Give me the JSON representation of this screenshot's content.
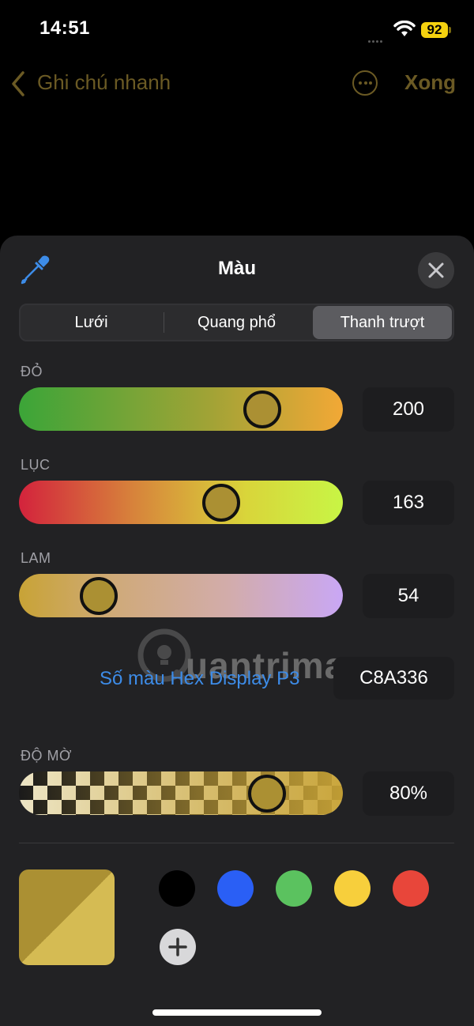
{
  "status_bar": {
    "time": "14:51",
    "battery": "92"
  },
  "nav": {
    "back_label": "Ghi chú nhanh",
    "done_label": "Xong"
  },
  "sheet": {
    "title": "Màu",
    "tabs": [
      {
        "label": "Lưới",
        "selected": false
      },
      {
        "label": "Quang phổ",
        "selected": false
      },
      {
        "label": "Thanh trượt",
        "selected": true
      }
    ]
  },
  "sliders": {
    "red": {
      "label": "ĐỎ",
      "value": "200",
      "fraction": 0.785
    },
    "green": {
      "label": "LỤC",
      "value": "163",
      "fraction": 0.64
    },
    "blue": {
      "label": "LAM",
      "value": "54",
      "fraction": 0.212
    },
    "opacity": {
      "label": "ĐỘ MỜ",
      "value": "80%",
      "fraction": 0.8
    }
  },
  "hex": {
    "label": "Số màu Hex Display P3",
    "value": "C8A336"
  },
  "colors": {
    "accent": "#6b5a24",
    "selected": "#c8a336",
    "selected_opaque": "#d5bb53",
    "selected_display": "#ab9033"
  },
  "swatches": [
    {
      "name": "black",
      "color": "#000000"
    },
    {
      "name": "blue",
      "color": "#2a5ff5"
    },
    {
      "name": "green",
      "color": "#5bc25f"
    },
    {
      "name": "yellow",
      "color": "#f7cf3c"
    },
    {
      "name": "red",
      "color": "#e8463a"
    }
  ],
  "watermark": {
    "text": "uantrimang"
  }
}
